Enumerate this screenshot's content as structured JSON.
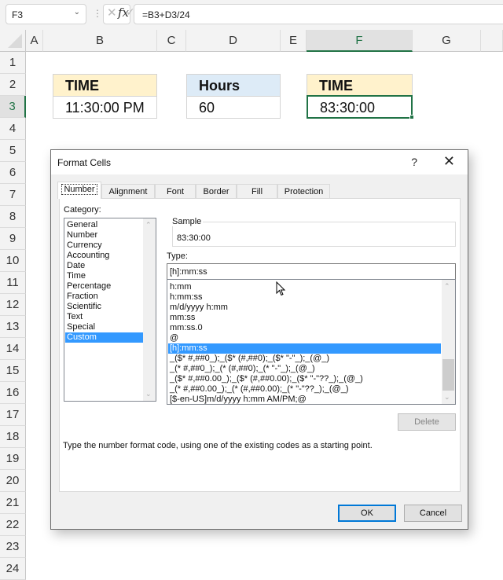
{
  "formula_bar": {
    "name_box": "F3",
    "formula": "=B3+D3/24",
    "cancel_icon": "✕",
    "enter_icon": "✓",
    "fx_icon": "fx"
  },
  "columns": [
    "A",
    "B",
    "C",
    "D",
    "E",
    "F",
    "G"
  ],
  "selected_column": "F",
  "rows": [
    "1",
    "2",
    "3",
    "4",
    "5",
    "6",
    "7",
    "8",
    "9",
    "10",
    "11",
    "12",
    "13",
    "14",
    "15",
    "16",
    "17",
    "18",
    "19",
    "20",
    "21",
    "22",
    "23",
    "24"
  ],
  "selected_row": "3",
  "cells": {
    "B2": "TIME",
    "B3": "11:30:00 PM",
    "D2": "Hours",
    "D3": "60",
    "F2": "TIME",
    "F3": "83:30:00"
  },
  "colors": {
    "excel_green": "#217346",
    "header_orange": "#fff2cc",
    "header_blue": "#ddebf7",
    "selection_blue": "#3399ff",
    "ok_border": "#0078d7"
  },
  "dialog": {
    "title": "Format Cells",
    "help": "?",
    "close": "✕",
    "tabs": [
      "Number",
      "Alignment",
      "Font",
      "Border",
      "Fill",
      "Protection"
    ],
    "active_tab": "Number",
    "category_label": "Category:",
    "categories": [
      "General",
      "Number",
      "Currency",
      "Accounting",
      "Date",
      "Time",
      "Percentage",
      "Fraction",
      "Scientific",
      "Text",
      "Special",
      "Custom"
    ],
    "selected_category": "Custom",
    "sample_label": "Sample",
    "sample_value": "83:30:00",
    "type_label": "Type:",
    "type_value": "[h]:mm:ss",
    "type_list": [
      "h:mm",
      "h:mm:ss",
      "m/d/yyyy h:mm",
      "mm:ss",
      "mm:ss.0",
      "@",
      "[h]:mm:ss",
      "_($* #,##0_);_($* (#,##0);_($* \"-\"_);_(@_)",
      "_(* #,##0_);_(* (#,##0);_(* \"-\"_);_(@_)",
      "_($* #,##0.00_);_($* (#,##0.00);_($* \"-\"??_);_(@_)",
      "_(* #,##0.00_);_(* (#,##0.00);_(* \"-\"??_);_(@_)",
      "[$-en-US]m/d/yyyy h:mm AM/PM;@"
    ],
    "selected_type": "[h]:mm:ss",
    "delete_label": "Delete",
    "hint": "Type the number format code, using one of the existing codes as a starting point.",
    "ok_label": "OK",
    "cancel_label": "Cancel"
  }
}
